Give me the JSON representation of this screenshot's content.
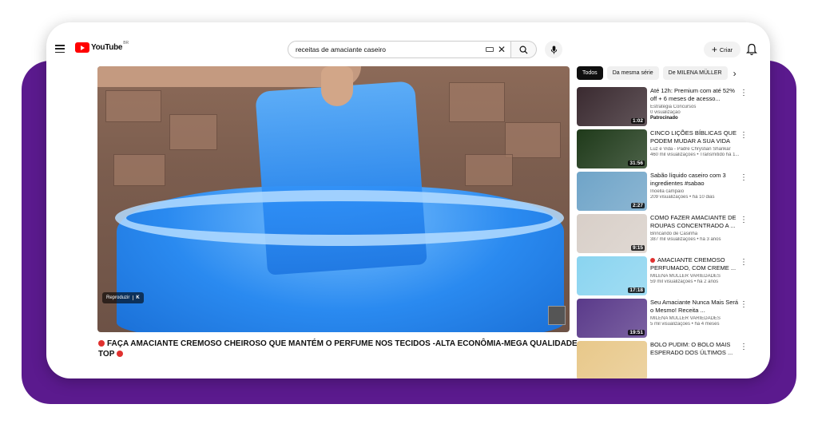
{
  "header": {
    "logo_text": "YouTube",
    "logo_country": "BR",
    "search_value": "receitas de amaciante caseiro",
    "create_label": "Criar"
  },
  "player": {
    "ad_label": "Reproduzir",
    "ad_key": "K"
  },
  "video": {
    "title": "FAÇA AMACIANTE CREMOSO CHEIROSO QUE MANTÉM O PERFUME NOS TECIDOS -ALTA ECONÔMIA-MEGA QUALIDADE TOP"
  },
  "chips": [
    {
      "label": "Todos"
    },
    {
      "label": "Da mesma série"
    },
    {
      "label": "De MILENA MÜLLER"
    }
  ],
  "sidebar": {
    "items": [
      {
        "title": "Até 12h: Premium com até 52% off + 6 meses de acesso...",
        "channel": "Estratégia Concursos",
        "stats": "0 visualização",
        "extra": "Patrocinado",
        "duration": "1:02",
        "color": "#3a2a30"
      },
      {
        "title": "CINCO LIÇÕES BÍBLICAS QUE PODEM MUDAR A SUA VIDA",
        "channel": "Luz e Vida - Padre Chrystian Shankar",
        "stats": "460 mil visualizações • Transmitido há 1...",
        "extra": "",
        "duration": "31:56",
        "color": "#1f3a1a"
      },
      {
        "title": "Sabão líquido caseiro com 3 ingredientes #sabao",
        "channel": "Inoella campaio",
        "stats": "209 visualizações • há 10 dias",
        "extra": "",
        "duration": "2:27",
        "color": "#6fa4c8"
      },
      {
        "title": "COMO FAZER AMACIANTE DE ROUPAS CONCENTRADO A ...",
        "channel": "Brincando de Casinha",
        "stats": "387 mil visualizações • há 3 anos",
        "extra": "",
        "duration": "9:15",
        "color": "#d8cfc8"
      },
      {
        "title": "AMACIANTE CREMOSO PERFUMADO, COM CREME ...",
        "channel": "MILENA MÜLLER VARIEDADES",
        "stats": "59 mil visualizações • há 2 anos",
        "extra": "",
        "duration": "17:18",
        "color": "#8ad4f0"
      },
      {
        "title": "Seu Amaciante Nunca Mais Será o Mesmo! Receita ...",
        "channel": "MILENA MÜLLER VARIEDADES",
        "stats": "5 mil visualizações • há 4 meses",
        "extra": "",
        "duration": "19:51",
        "color": "#5a3a8a"
      },
      {
        "title": "BOLO PUDIM: O BOLO MAIS ESPERADO DOS ÚLTIMOS ...",
        "channel": "",
        "stats": "",
        "extra": "",
        "duration": "",
        "color": "#e8c88a"
      }
    ]
  }
}
